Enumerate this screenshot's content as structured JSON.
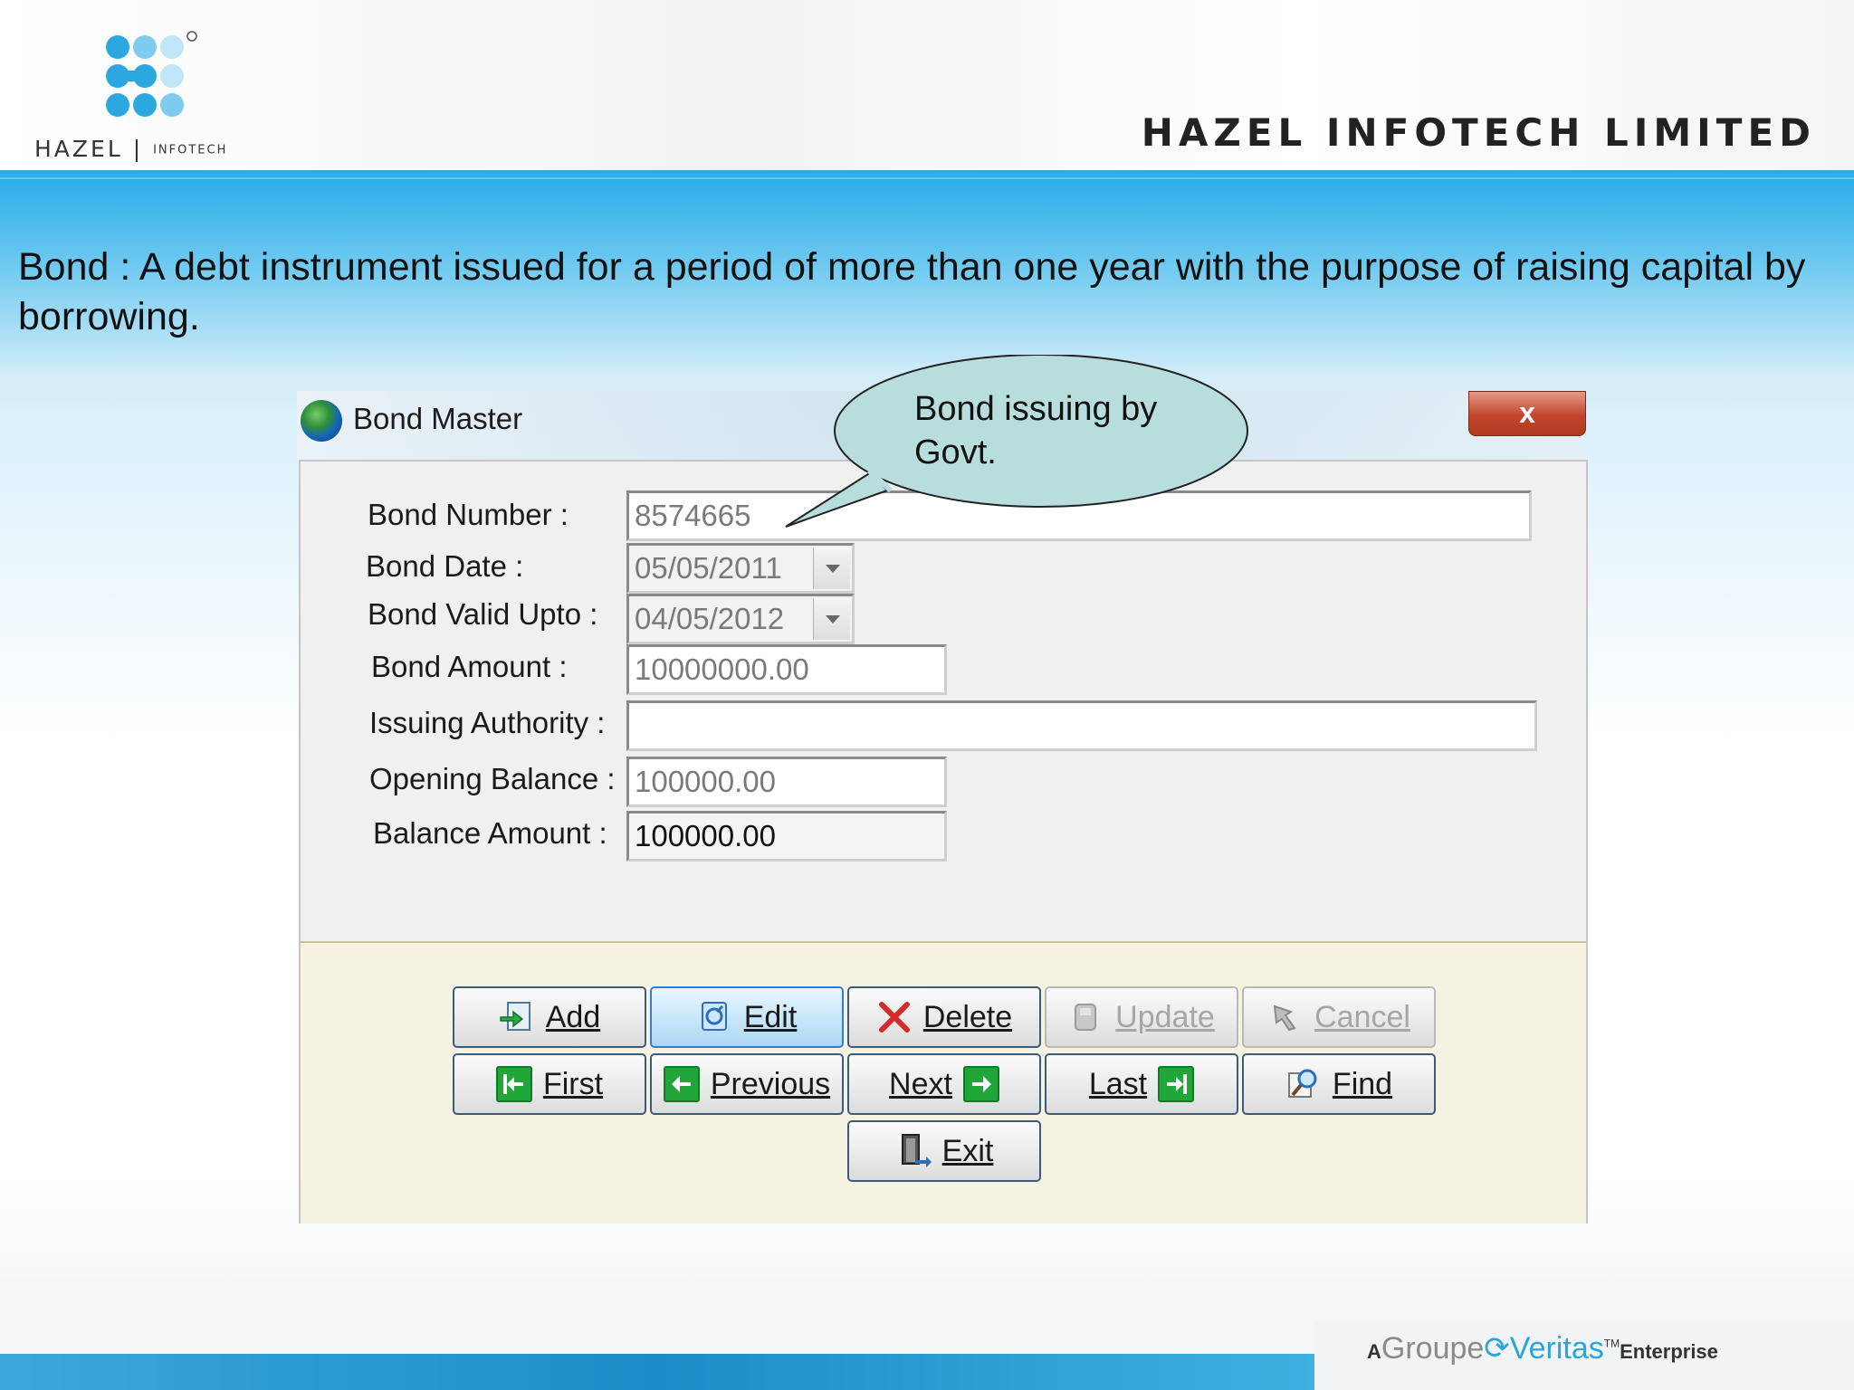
{
  "header": {
    "logo_text": "HAZEL",
    "logo_subtext": "INFOTECH",
    "company_name": "HAZEL INFOTECH LIMITED"
  },
  "definition_text": "Bond : A debt instrument issued for a period of more than one year with the purpose of raising capital by borrowing.",
  "dialog": {
    "title": "Bond Master",
    "close_label": "x",
    "fields": {
      "bond_number": {
        "label": "Bond Number :",
        "value": "8574665"
      },
      "bond_date": {
        "label": "Bond Date :",
        "value": "05/05/2011"
      },
      "bond_valid_upto": {
        "label": "Bond Valid Upto :",
        "value": "04/05/2012"
      },
      "bond_amount": {
        "label": "Bond Amount :",
        "value": "10000000.00"
      },
      "issuing_authority": {
        "label": "Issuing Authority :",
        "value": ""
      },
      "opening_balance": {
        "label": "Opening Balance :",
        "value": "100000.00"
      },
      "balance_amount": {
        "label": "Balance Amount :",
        "value": "100000.00"
      }
    },
    "buttons": {
      "add": "Add",
      "edit": "Edit",
      "delete": "Delete",
      "update": "Update",
      "cancel": "Cancel",
      "first": "First",
      "previous": "Previous",
      "next": "Next",
      "last": "Last",
      "find": "Find",
      "exit": "Exit"
    }
  },
  "callout": {
    "text_line1": "Bond issuing by",
    "text_line2": "Govt."
  },
  "footer": {
    "brand_prefix": "A",
    "brand_groupe": "Groupe",
    "brand_veritas": "Veritas",
    "brand_tm": "TM",
    "brand_suffix": "Enterprise"
  },
  "colors": {
    "accent_blue": "#2aaee8",
    "callout_fill": "#b7dedd",
    "close_red": "#c2452c"
  }
}
